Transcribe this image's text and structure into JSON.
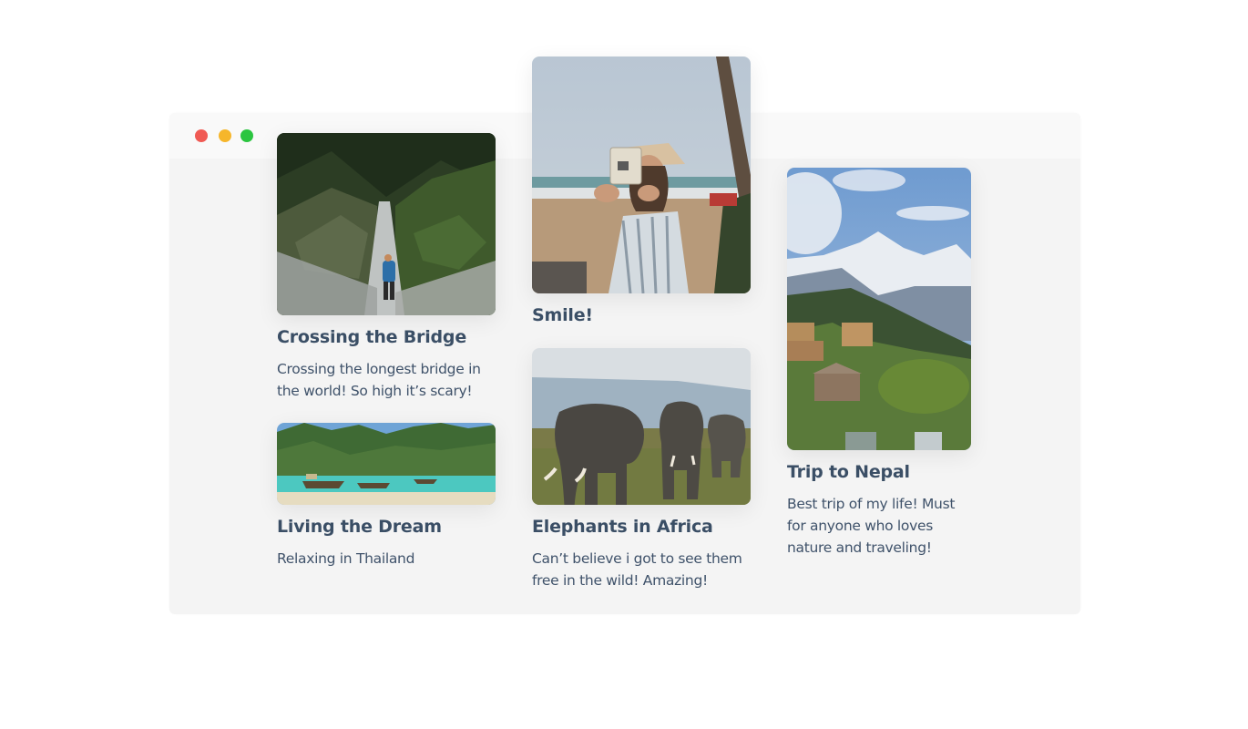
{
  "window": {
    "controls": [
      {
        "name": "close",
        "color": "#f05a54"
      },
      {
        "name": "minimize",
        "color": "#f6b62b"
      },
      {
        "name": "maximize",
        "color": "#2bc540"
      }
    ]
  },
  "cards": {
    "bridge": {
      "image": "suspension-bridge-forest-photo",
      "title": "Crossing the Bridge",
      "description": "Crossing the longest bridge in the world! So high it’s scary!"
    },
    "thailand": {
      "image": "thailand-beach-longtail-boats-photo",
      "title": "Living the Dream",
      "description": "Relaxing in Thailand"
    },
    "smile": {
      "image": "woman-with-instant-camera-beach-photo",
      "title": "Smile!"
    },
    "elephants": {
      "image": "elephants-savanna-photo",
      "title": "Elephants in Africa",
      "description": "Can’t believe i got to see them free in the wild! Amazing!"
    },
    "nepal": {
      "image": "nepal-mountain-village-photo",
      "title": "Trip to Nepal",
      "description": "Best trip of my life! Must for anyone who loves nature and traveling!"
    }
  }
}
